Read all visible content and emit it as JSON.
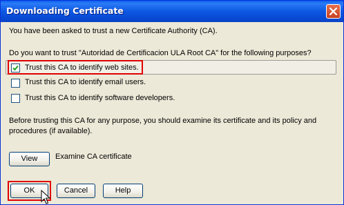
{
  "window": {
    "title": "Downloading Certificate"
  },
  "intro_text": "You have been asked to trust a new Certificate Authority (CA).",
  "question_text": "Do you want to trust \"Autoridad de Certificacion ULA Root CA\" for the following purposes?",
  "purposes": [
    {
      "label": "Trust this CA to identify web sites.",
      "checked": true
    },
    {
      "label": "Trust this CA to identify email users.",
      "checked": false
    },
    {
      "label": "Trust this CA to identify software developers.",
      "checked": false
    }
  ],
  "advice_line1": "Before trusting this CA for any purpose, you should examine its certificate and its policy and",
  "advice_line2": "procedures (if available).",
  "view_button": "View",
  "examine_label": "Examine CA certificate",
  "buttons": {
    "ok": "OK",
    "cancel": "Cancel",
    "help": "Help"
  },
  "highlight_color": "#e00000"
}
